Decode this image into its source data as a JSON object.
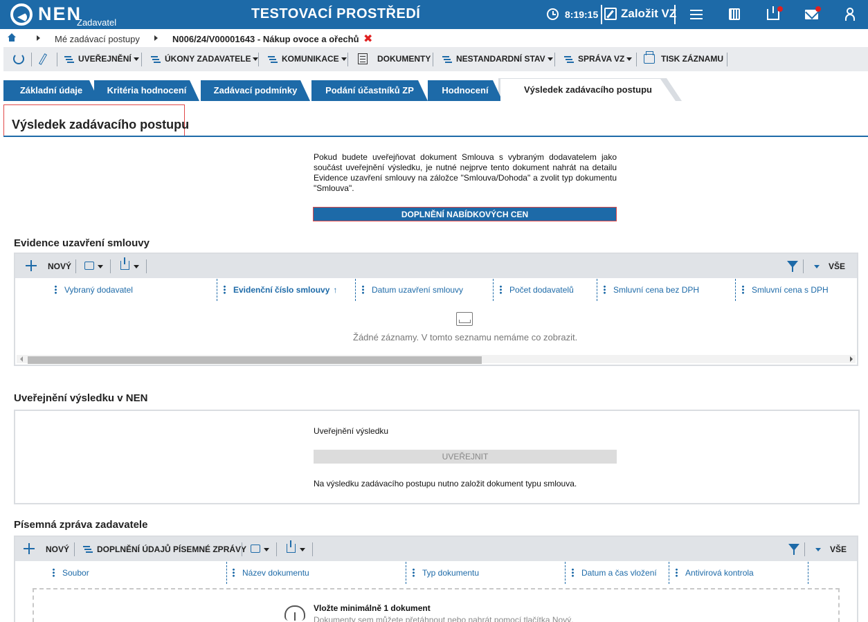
{
  "topbar": {
    "logo_text": "NEN",
    "logo_sub": "Zadavatel",
    "env_title": "TESTOVACÍ PROSTŘEDÍ",
    "time": "8:19:15",
    "create_label": "Založit VZ",
    "accent": "#1d6aa8"
  },
  "breadcrumb": {
    "item1": "Mé zadávací postupy",
    "item2": "N006/24/V00001643 - Nákup ovoce a ořechů",
    "close": "✖"
  },
  "actionbar": {
    "publish": "UVEŘEJNĚNÍ",
    "acts": "ÚKONY ZADAVATELE",
    "communication": "KOMUNIKACE",
    "documents": "DOKUMENTY",
    "nonstandard": "NESTANDARDNÍ STAV",
    "management": "SPRÁVA VZ",
    "print": "TISK ZÁZNAMU"
  },
  "tabs": [
    {
      "label": "Základní údaje"
    },
    {
      "label": "Kritéria hodnocení"
    },
    {
      "label": "Zadávací podmínky"
    },
    {
      "label": "Podání účastníků ZP"
    },
    {
      "label": "Hodnocení"
    },
    {
      "label": "Výsledek zadávacího postupu"
    }
  ],
  "main": {
    "heading": "Výsledek zadávacího postupu",
    "info_text": "Pokud budete uveřejňovat dokument Smlouva s vybraným dodavatelem jako součást uveřejnění výsledku, je nutné nejprve tento dokument nahrát na detailu Evidence uzavření smlouvy na záložce \"Smlouva/Dohoda\" a zvolit typ dokumentu \"Smlouva\".",
    "prices_button": "DOPLNĚNÍ NABÍDKOVÝCH CEN"
  },
  "contracts": {
    "title": "Evidence uzavření smlouvy",
    "new_label": "NOVÝ",
    "all_label": "VŠE",
    "columns": [
      "Vybraný dodavatel",
      "Evidenční číslo smlouvy",
      "Datum uzavření smlouvy",
      "Počet dodavatelů",
      "Smluvní cena bez DPH",
      "Smluvní cena s DPH"
    ],
    "sort_mark": "↑",
    "empty_text": "Žádné záznamy. V tomto seznamu nemáme co zobrazit."
  },
  "publication": {
    "title": "Uveřejnění výsledku v NEN",
    "subtitle": "Uveřejnění výsledku",
    "button": "UVEŘEJNIT",
    "note": "Na výsledku zadávacího postupu nutno založit dokument typu smlouva."
  },
  "report": {
    "title": "Písemná zpráva zadavatele",
    "new_label": "NOVÝ",
    "fill_label": "DOPLNĚNÍ ÚDAJŮ PÍSEMNÉ ZPRÁVY",
    "all_label": "VŠE",
    "columns": [
      "Soubor",
      "Název dokumentu",
      "Typ dokumentu",
      "Datum a čas vložení",
      "Antivirová kontrola"
    ],
    "dropzone_title": "Vložte minimálně 1 dokument",
    "dropzone_sub": "Dokumenty sem můžete přetáhnout nebo nahrát pomocí tlačítka Nový."
  }
}
